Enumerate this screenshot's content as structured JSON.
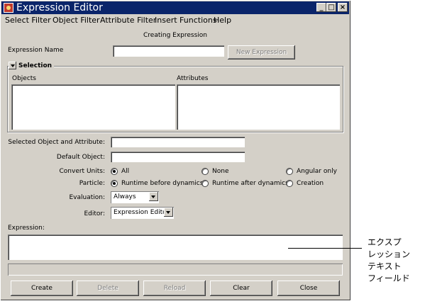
{
  "window": {
    "title": "Expression Editor",
    "buttons": {
      "minimize": "_",
      "maximize": "□",
      "close": "×"
    }
  },
  "menu": {
    "items": [
      "Select Filter",
      "Object Filter",
      "Attribute Filter",
      "Insert Functions",
      "Help"
    ]
  },
  "status_heading": "Creating Expression",
  "expression_name": {
    "label": "Expression Name",
    "value": "",
    "new_button": "New Expression"
  },
  "selection": {
    "title": "Selection",
    "objects_label": "Objects",
    "attributes_label": "Attributes"
  },
  "form": {
    "selected_object_label": "Selected Object and Attribute:",
    "selected_object_value": "",
    "default_object_label": "Default Object:",
    "default_object_value": "",
    "convert_units_label": "Convert Units:",
    "convert_units_options": [
      "All",
      "None",
      "Angular only"
    ],
    "convert_units_selected": "All",
    "particle_label": "Particle:",
    "particle_options": [
      "Runtime before dynamics",
      "Runtime after dynamics",
      "Creation"
    ],
    "particle_selected": "Runtime before dynamics",
    "evaluation_label": "Evaluation:",
    "evaluation_value": "Always",
    "editor_label": "Editor:",
    "editor_value": "Expression Editor"
  },
  "expression": {
    "label": "Expression:",
    "value": ""
  },
  "buttons": {
    "create": "Create",
    "delete": "Delete",
    "reload": "Reload",
    "clear": "Clear",
    "close": "Close"
  },
  "annotation": {
    "lines": [
      "エクスプ",
      "レッション",
      "テキスト",
      "フィールド"
    ]
  },
  "colors": {
    "titlebar": "#0a246a",
    "window_bg": "#d4d0c8",
    "field_bg": "#ffffff",
    "disabled_text": "#808080"
  }
}
